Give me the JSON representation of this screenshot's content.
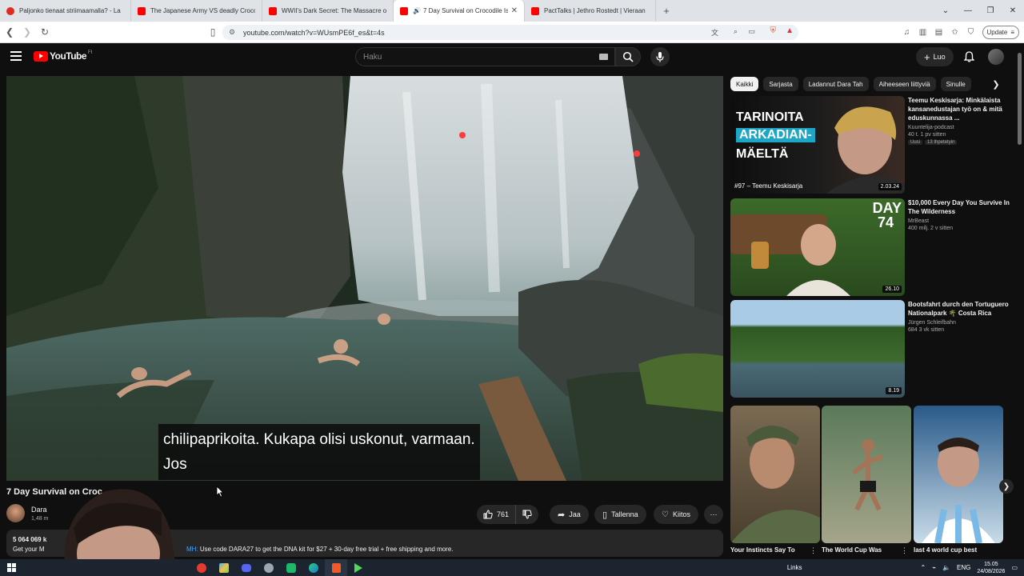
{
  "browser": {
    "tabs": [
      {
        "title": "Paljonko tienaat striimaamalla? - La",
        "color": "#e02b20"
      },
      {
        "title": "The Japanese Army VS deadly Crocodi",
        "color": "#ff0000"
      },
      {
        "title": "WWII's Dark Secret: The Massacre of",
        "color": "#ff0000"
      },
      {
        "title": "7 Day Survival on Crocodile Is",
        "color": "#ff0000",
        "active": true
      },
      {
        "title": "PactTalks | Jethro Rostedt | Vieraan",
        "color": "#ff0000"
      }
    ],
    "url": "youtube.com/watch?v=WUsmPE6f_es&t=4s",
    "update_label": "Update"
  },
  "youtube": {
    "logo": "YouTube",
    "region": "FI",
    "search_placeholder": "Haku",
    "create_label": "Luo"
  },
  "video": {
    "caption_line1": "chilipaprikoita.  Kukapa olisi uskonut, varmaan.",
    "caption_line2": "Jos",
    "title": "7 Day Survival on Croc",
    "channel": "Dara",
    "subs": "1,48 m",
    "likes": "761",
    "share": "Jaa",
    "save": "Tallenna",
    "thanks": "Kiitos",
    "views": "5 064 069 k",
    "desc_line": "Get your M",
    "promo_prefix": "MH:",
    "promo_text": " Use code DARA27 to get the DNA kit for $27 + 30-day free trial + free shipping and more."
  },
  "chips": [
    "Kaikki",
    "Sarjasta",
    "Ladannut Dara Tah",
    "Aiheeseen liittyviä",
    "Sinulle"
  ],
  "recommendations": [
    {
      "title": "Teemu Keskisarja: Minkälaista kansanedustajan työ on & mitä eduskunnassa ...",
      "channel": "Kuuntelija-podcast",
      "meta": "40 t.  1 pv sitten",
      "badges": [
        "Uusi",
        "13 Ihpetetyin"
      ],
      "duration": "2.03.24",
      "thumb_line1": "TARINOITA",
      "thumb_line2": "ARKADIAN-",
      "thumb_line3": "MÄELTÄ",
      "thumb_footer": "#97 – Teemu Keskisarja"
    },
    {
      "title": "$10,000 Every Day You Survive In The Wilderness",
      "channel": "MrBeast",
      "meta": "400 milj.  2 v sitten",
      "duration": "26.10",
      "thumb_line1": "DAY",
      "thumb_line2": "74"
    },
    {
      "title": "Bootsfahrt durch den Tortuguero Nationalpark 🌴 Costa Rica",
      "channel": "Jürgen Schleifbahn",
      "meta": "684  3 vk sitten",
      "duration": "8.19"
    }
  ],
  "shorts": [
    {
      "title": "Your Instincts Say To"
    },
    {
      "title": "The World Cup Was"
    },
    {
      "title": "last 4 world cup best"
    }
  ],
  "taskbar": {
    "links": "Links",
    "lang": "ENG",
    "time": "15.05",
    "date": "24/08/2026"
  },
  "colors": {
    "accent": "#ff0000",
    "background": "#0f0f0f",
    "surface": "#272727",
    "link": "#3ea6ff"
  }
}
